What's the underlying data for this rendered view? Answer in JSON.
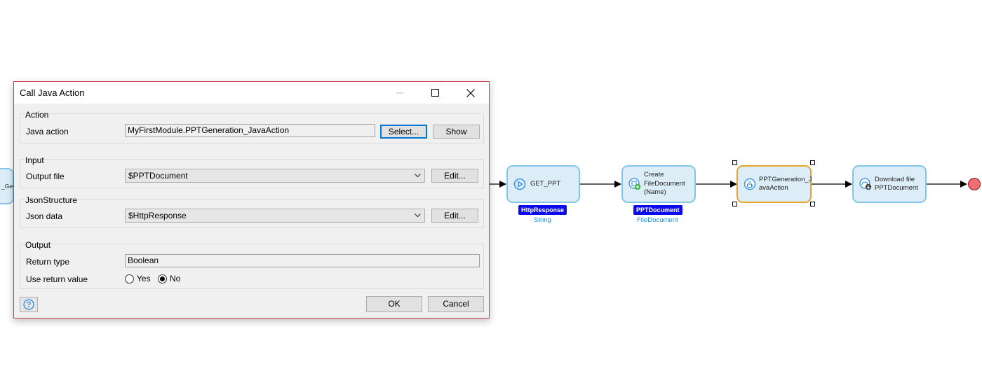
{
  "dialog": {
    "title": "Call Java Action",
    "action_group": {
      "title": "Action",
      "java_action_label": "Java action",
      "java_action_value": "MyFirstModule.PPTGeneration_JavaAction",
      "select_button": "Select...",
      "show_button": "Show"
    },
    "input_group": {
      "title": "Input",
      "output_file_label": "Output file",
      "output_file_value": "$PPTDocument",
      "edit_button": "Edit..."
    },
    "json_group": {
      "title": "JsonStructure",
      "json_data_label": "Json data",
      "json_data_value": "$HttpResponse",
      "edit_button": "Edit..."
    },
    "output_group": {
      "title": "Output",
      "return_type_label": "Return type",
      "return_type_value": "Boolean",
      "use_return_label": "Use return value",
      "options": [
        "Yes",
        "No"
      ],
      "selected": "No"
    },
    "ok_button": "OK",
    "cancel_button": "Cancel",
    "help_icon": "help-icon"
  },
  "microflow": {
    "partial_node_label": "_Get",
    "nodes": [
      {
        "id": "get-ppt",
        "label": "GET_PPT",
        "icon": "play-circle-icon",
        "output_var": "HttpResponse",
        "output_type": "String"
      },
      {
        "id": "create-filedocument",
        "label": "Create FileDocument (Name)",
        "lines": [
          "Create",
          "FileDocument",
          "(Name)"
        ],
        "icon": "create-object-icon",
        "output_var": "PPTDocument",
        "output_type": "FileDocument"
      },
      {
        "id": "pptgeneration-javaaction",
        "lines": [
          "PPTGeneration_J",
          "avaAction"
        ],
        "icon": "java-cup-icon",
        "selected": true
      },
      {
        "id": "download-file",
        "lines": [
          "Download file",
          "PPTDocument"
        ],
        "icon": "download-icon"
      }
    ],
    "end_event_color": "#f26e74",
    "selection_color": "#e7a62a",
    "variable_badge_color": "#0a0aeb"
  }
}
